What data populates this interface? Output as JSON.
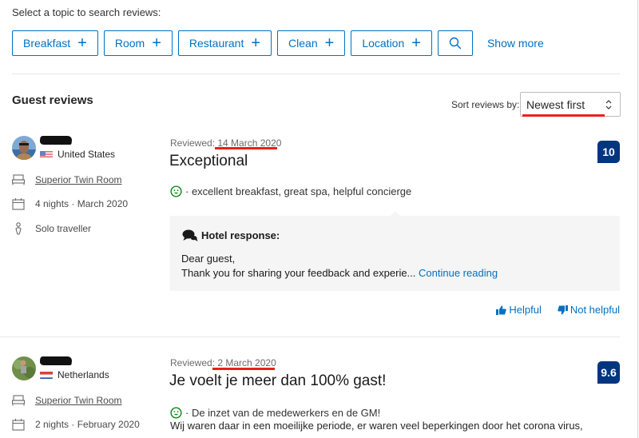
{
  "filters": {
    "prompt": "Select a topic to search reviews:",
    "topics": [
      {
        "label": "Breakfast",
        "icon": "plus-icon"
      },
      {
        "label": "Room",
        "icon": "plus-icon"
      },
      {
        "label": "Restaurant",
        "icon": "plus-icon"
      },
      {
        "label": "Clean",
        "icon": "plus-icon"
      },
      {
        "label": "Location",
        "icon": "plus-icon"
      }
    ],
    "plus_glyph": "+",
    "search_icon": "search-icon",
    "show_more": "Show more"
  },
  "reviews_section": {
    "title": "Guest reviews",
    "sort_label": "Sort reviews by:",
    "sort_selected": "Newest first"
  },
  "colors": {
    "accent": "#0071c2",
    "score_bg": "#003580",
    "annotation_red": "#e8211a",
    "positive_green": "#008009",
    "response_bg": "#f5f5f5"
  },
  "reviews": [
    {
      "country": "United States",
      "flag": "us",
      "room": "Superior Twin Room",
      "stay": "4 nights · March 2020",
      "traveller_type": "Solo traveller",
      "reviewed_prefix": "Reviewed: ",
      "reviewed_date": "14 March 2020",
      "title": "Exceptional",
      "score": "10",
      "positive": "· excellent breakfast, great spa, helpful concierge",
      "hotel_response": {
        "heading": "Hotel response:",
        "line1": "Dear guest,",
        "line2": "Thank you for sharing your feedback and experie...",
        "continue": "Continue reading"
      },
      "helpful": "Helpful",
      "not_helpful": "Not helpful"
    },
    {
      "country": "Netherlands",
      "flag": "nl",
      "room": "Superior Twin Room",
      "stay": "2 nights · February 2020",
      "reviewed_prefix": "Reviewed: ",
      "reviewed_date": "2 March 2020",
      "title": "Je voelt je meer dan 100% gast!",
      "score": "9.6",
      "positive": "· De inzet van de medewerkers en de GM!",
      "body": "Wij waren daar in een moeilijke periode, er waren veel beperkingen door het corona virus,"
    }
  ]
}
